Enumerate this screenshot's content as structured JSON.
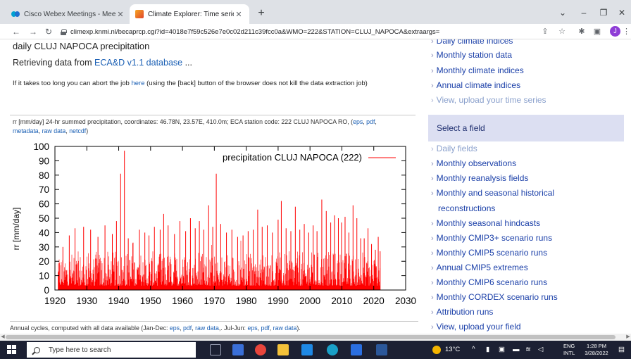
{
  "browser": {
    "tabs": [
      {
        "title": "Cisco Webex Meetings - Meeting",
        "icon": "webex-icon",
        "active": false
      },
      {
        "title": "Climate Explorer: Time series",
        "icon": "knmi-icon",
        "active": true
      }
    ],
    "url": "climexp.knmi.nl/becaprcp.cgi?id=4018e7f59c526e7e0c02d211c39fcc0a&WMO=222&STATION=CLUJ_NAPOCA&extraargs=",
    "profile_initial": "J"
  },
  "page": {
    "title": "daily CLUJ NAPOCA precipitation",
    "retrieving_prefix": "Retrieving data from ",
    "retrieving_link": "ECA&D v1.1 database",
    "retrieving_suffix": " ...",
    "abort_prefix": "If it takes too long you can abort the job ",
    "abort_link": "here",
    "abort_suffix": " (using the [back] button of the browser does not kill the data extraction job)",
    "meta_text": "rr [mm/day] 24-hr summed precipitation, coordinates: 46.78N, 23.57E, 410.0m; ECA station code: 222 CLUJ NAPOCA RO, (",
    "meta_links": [
      "eps",
      "pdf",
      "metadata",
      "raw data",
      "netcdf"
    ],
    "meta_close": ")",
    "annual_prefix": "Annual cycles, computed with all data available (Jan-Dec: ",
    "annual_links_1": [
      "eps",
      "pdf",
      "raw data"
    ],
    "annual_mid": ",. Jul-Jun: ",
    "annual_links_2": [
      "eps",
      "pdf",
      "raw data"
    ],
    "annual_suffix": ")."
  },
  "chart_data": {
    "type": "bar",
    "ylabel": "rr [mm/day]",
    "xlim": [
      1920,
      2030
    ],
    "ylim": [
      0,
      100
    ],
    "x_ticks": [
      1920,
      1930,
      1940,
      1950,
      1960,
      1970,
      1980,
      1990,
      2000,
      2010,
      2020,
      2030
    ],
    "y_ticks": [
      0,
      10,
      20,
      30,
      40,
      50,
      60,
      70,
      80,
      90,
      100
    ],
    "legend": "precipitation CLUJ NAPOCA (222)",
    "series_color": "#ff0000",
    "data_range": [
      1921,
      2022
    ],
    "peaks": [
      {
        "x": 1922.5,
        "y": 30
      },
      {
        "x": 1924.5,
        "y": 38
      },
      {
        "x": 1926.3,
        "y": 43
      },
      {
        "x": 1929.0,
        "y": 44
      },
      {
        "x": 1931.2,
        "y": 42
      },
      {
        "x": 1933.5,
        "y": 37
      },
      {
        "x": 1935.7,
        "y": 45
      },
      {
        "x": 1938.0,
        "y": 39
      },
      {
        "x": 1939.3,
        "y": 48
      },
      {
        "x": 1940.6,
        "y": 81
      },
      {
        "x": 1941.8,
        "y": 97
      },
      {
        "x": 1943.0,
        "y": 36
      },
      {
        "x": 1944.5,
        "y": 33
      },
      {
        "x": 1946.5,
        "y": 42
      },
      {
        "x": 1948.2,
        "y": 40
      },
      {
        "x": 1949.5,
        "y": 38
      },
      {
        "x": 1951.2,
        "y": 44
      },
      {
        "x": 1953.0,
        "y": 42
      },
      {
        "x": 1954.1,
        "y": 53
      },
      {
        "x": 1955.5,
        "y": 45
      },
      {
        "x": 1957.5,
        "y": 39
      },
      {
        "x": 1959.2,
        "y": 48
      },
      {
        "x": 1961.0,
        "y": 41
      },
      {
        "x": 1962.5,
        "y": 50
      },
      {
        "x": 1964.0,
        "y": 43
      },
      {
        "x": 1965.3,
        "y": 48
      },
      {
        "x": 1966.7,
        "y": 42
      },
      {
        "x": 1968.2,
        "y": 59
      },
      {
        "x": 1969.5,
        "y": 44
      },
      {
        "x": 1970.6,
        "y": 81
      },
      {
        "x": 1972.0,
        "y": 46
      },
      {
        "x": 1973.8,
        "y": 40
      },
      {
        "x": 1975.5,
        "y": 42
      },
      {
        "x": 1977.3,
        "y": 37
      },
      {
        "x": 1979.0,
        "y": 38
      },
      {
        "x": 1980.6,
        "y": 41
      },
      {
        "x": 1982.2,
        "y": 42
      },
      {
        "x": 1983.6,
        "y": 56
      },
      {
        "x": 1985.0,
        "y": 44
      },
      {
        "x": 1986.6,
        "y": 45
      },
      {
        "x": 1988.2,
        "y": 40
      },
      {
        "x": 1990.0,
        "y": 49
      },
      {
        "x": 1991.0,
        "y": 62
      },
      {
        "x": 1992.5,
        "y": 43
      },
      {
        "x": 1994.0,
        "y": 41
      },
      {
        "x": 1995.4,
        "y": 58
      },
      {
        "x": 1996.8,
        "y": 42
      },
      {
        "x": 1998.2,
        "y": 46
      },
      {
        "x": 1999.6,
        "y": 40
      },
      {
        "x": 2001.0,
        "y": 45
      },
      {
        "x": 2002.2,
        "y": 41
      },
      {
        "x": 2003.7,
        "y": 63
      },
      {
        "x": 2005.1,
        "y": 55
      },
      {
        "x": 2006.5,
        "y": 47
      },
      {
        "x": 2007.7,
        "y": 52
      },
      {
        "x": 2008.9,
        "y": 50
      },
      {
        "x": 2009.9,
        "y": 47
      },
      {
        "x": 2011.0,
        "y": 51
      },
      {
        "x": 2012.2,
        "y": 40
      },
      {
        "x": 2013.5,
        "y": 59
      },
      {
        "x": 2014.7,
        "y": 50
      },
      {
        "x": 2015.9,
        "y": 36
      },
      {
        "x": 2017.0,
        "y": 36
      },
      {
        "x": 2018.2,
        "y": 43
      },
      {
        "x": 2019.3,
        "y": 32
      },
      {
        "x": 2020.5,
        "y": 28
      },
      {
        "x": 2021.4,
        "y": 37
      },
      {
        "x": 2022.0,
        "y": 27
      }
    ]
  },
  "sidebar": {
    "top_items": [
      {
        "label": "Daily climate indices",
        "muted": false
      },
      {
        "label": "Monthly station data",
        "muted": false
      },
      {
        "label": "Monthly climate indices",
        "muted": false
      },
      {
        "label": "Annual climate indices",
        "muted": false
      },
      {
        "label": "View, upload your time series",
        "muted": true
      }
    ],
    "section_header": "Select a field",
    "field_items": [
      {
        "label": "Daily fields",
        "muted": true
      },
      {
        "label": "Monthly observations",
        "muted": false
      },
      {
        "label": "Monthly reanalysis fields",
        "muted": false
      },
      {
        "label": "Monthly and seasonal historical",
        "muted": false
      },
      {
        "label": "reconstructions",
        "muted": false,
        "continuation": true
      },
      {
        "label": "Monthly seasonal hindcasts",
        "muted": false
      },
      {
        "label": "Monthly CMIP3+ scenario runs",
        "muted": false
      },
      {
        "label": "Monthly CMIP5 scenario runs",
        "muted": false
      },
      {
        "label": "Annual CMIP5 extremes",
        "muted": false
      },
      {
        "label": "Monthly CMIP6 scenario runs",
        "muted": false
      },
      {
        "label": "Monthly CORDEX scenario runs",
        "muted": false
      },
      {
        "label": "Attribution runs",
        "muted": false
      },
      {
        "label": "View, upload your field",
        "muted": false
      }
    ]
  },
  "taskbar": {
    "search_placeholder": "Type here to search",
    "weather": "13°C",
    "lang_top": "ENG",
    "lang_bottom": "INTL",
    "time": "1:28 PM",
    "date": "3/28/2022",
    "apps": [
      {
        "name": "task-view-icon",
        "color": "#2d3347"
      },
      {
        "name": "widgets-icon",
        "color": "#3a6fd8"
      },
      {
        "name": "chrome-icon",
        "color": "#e8453c"
      },
      {
        "name": "file-explorer-icon",
        "color": "#f3c13a"
      },
      {
        "name": "mail-icon",
        "color": "#1e88e5"
      },
      {
        "name": "edge-icon",
        "color": "#1aa0c8"
      },
      {
        "name": "store-icon",
        "color": "#2a6ee0"
      },
      {
        "name": "word-icon",
        "color": "#2b579a"
      }
    ]
  }
}
